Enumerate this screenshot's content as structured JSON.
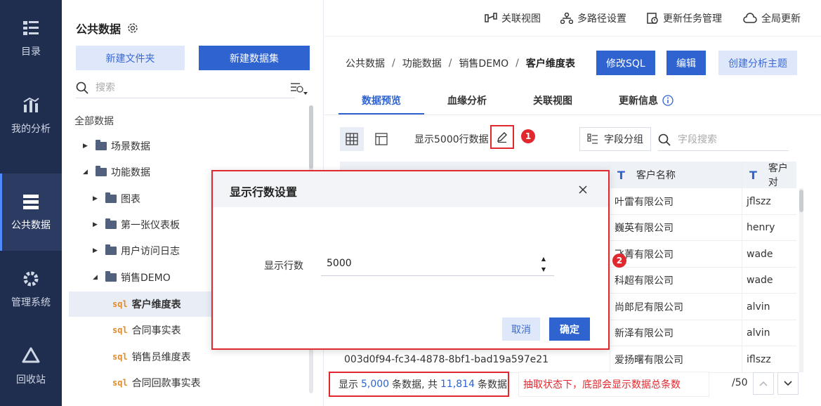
{
  "nav": {
    "items": [
      {
        "label": "目录",
        "icon": "catalog-icon"
      },
      {
        "label": "我的分析",
        "icon": "analysis-icon"
      },
      {
        "label": "公共数据",
        "icon": "public-data-icon",
        "active": true
      },
      {
        "label": "管理系统",
        "icon": "gear-icon"
      },
      {
        "label": "回收站",
        "icon": "recycle-icon"
      }
    ]
  },
  "panel": {
    "title": "公共数据",
    "new_folder": "新建文件夹",
    "new_dataset": "新建数据集",
    "search_placeholder": "搜索",
    "root": "全部数据",
    "tree": [
      {
        "label": "场景数据",
        "type": "folder",
        "expanded": false
      },
      {
        "label": "功能数据",
        "type": "folder",
        "expanded": true
      },
      {
        "label": "图表",
        "type": "folder",
        "expanded": false
      },
      {
        "label": "第一张仪表板",
        "type": "folder",
        "expanded": false
      },
      {
        "label": "用户访问日志",
        "type": "folder",
        "expanded": false
      },
      {
        "label": "销售DEMO",
        "type": "folder",
        "expanded": true
      },
      {
        "label": "客户维度表",
        "type": "sql",
        "selected": true
      },
      {
        "label": "合同事实表",
        "type": "sql"
      },
      {
        "label": "销售员维度表",
        "type": "sql"
      },
      {
        "label": "合同回款事实表",
        "type": "sql"
      }
    ],
    "sql_badge": "sql"
  },
  "topbar": {
    "actions": [
      "关联视图",
      "多路径设置",
      "更新任务管理",
      "全局更新"
    ]
  },
  "breadcrumb": {
    "parts": [
      "公共数据",
      "功能数据",
      "销售DEMO"
    ],
    "current": "客户维度表",
    "sep": "/"
  },
  "header_buttons": {
    "edit_sql": "修改SQL",
    "edit": "编辑",
    "create_topic": "创建分析主题"
  },
  "tabs": [
    "数据预览",
    "血缘分析",
    "关联视图",
    "更新信息"
  ],
  "toolbar": {
    "rows_text": "显示5000行数据",
    "group_btn": "字段分组",
    "field_search_placeholder": "字段搜索"
  },
  "markers": [
    "1",
    "2"
  ],
  "table": {
    "headers": [
      "客户名称",
      "客户对"
    ],
    "header_icon": "T",
    "rows": [
      {
        "name": "叶雷有限公司",
        "contact": "jflszz"
      },
      {
        "name": "巍英有限公司",
        "contact": "henry"
      },
      {
        "name": "飞菁有限公司",
        "contact": "wade"
      },
      {
        "name": "科超有限公司",
        "contact": "wade"
      },
      {
        "name": "尚郎尼有限公司",
        "contact": "alvin"
      },
      {
        "name": "新泽有限公司",
        "contact": "alvin"
      },
      {
        "id": "003d0f94-fc34-4878-8bf1-bad19a597e21",
        "name": "爱扬曙有限公司",
        "contact": "iflszz"
      }
    ]
  },
  "footer": {
    "prefix": "显示",
    "shown": "5,000",
    "middle": "条数据, 共",
    "total": "11,814",
    "suffix": "条数据",
    "note": "抽取状态下，底部会显示数据总条数",
    "page_total": "/50"
  },
  "dialog": {
    "title": "显示行数设置",
    "label": "显示行数",
    "value": "5000",
    "cancel": "取消",
    "ok": "确定"
  },
  "colors": {
    "nav_bg": "#1f2d4f",
    "primary": "#2e63d0",
    "highlight": "#e0282e"
  }
}
